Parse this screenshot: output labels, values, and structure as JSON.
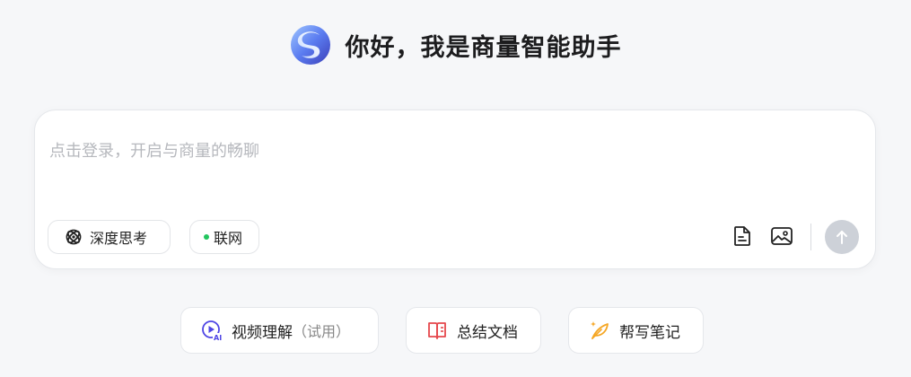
{
  "header": {
    "title": "你好，我是商量智能助手",
    "logo_icon": "sensenova-logo-icon"
  },
  "composer": {
    "placeholder": "点击登录，开启与商量的畅聊",
    "deep_think_label": "深度思考",
    "deep_think_icon": "brain-atom-icon",
    "web_label": "联网",
    "web_status_color": "#22c55e",
    "file_icon": "document-icon",
    "image_icon": "image-icon",
    "send_icon": "arrow-up-icon",
    "send_color": "#cdd1d8"
  },
  "quick_actions": [
    {
      "label": "视频理解",
      "hint": "（试用）",
      "icon": "video-ai-icon"
    },
    {
      "label": "总结文档",
      "icon": "book-summary-icon"
    },
    {
      "label": "帮写笔记",
      "icon": "feather-pen-icon"
    }
  ]
}
